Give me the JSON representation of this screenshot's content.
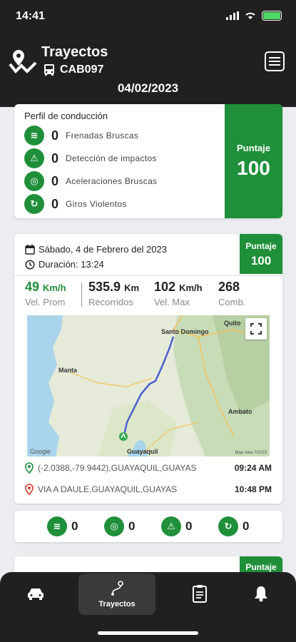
{
  "status_bar": {
    "time": "14:41"
  },
  "header": {
    "title": "Trayectos",
    "vehicle": "CAB097",
    "date": "04/02/2023"
  },
  "profile": {
    "title": "Perfil de conducción",
    "metrics": [
      {
        "value": "0",
        "label": "Frenadas Bruscas",
        "icon": "hard-brake-icon"
      },
      {
        "value": "0",
        "label": "Detección de impactos",
        "icon": "impact-detection-icon"
      },
      {
        "value": "0",
        "label": "Aceleraciones Bruscas",
        "icon": "hard-acceleration-icon"
      },
      {
        "value": "0",
        "label": "Giros Violentos",
        "icon": "sharp-turn-icon"
      }
    ],
    "score_label": "Puntaje",
    "score_value": "100"
  },
  "trip": {
    "date": "Sábado, 4 de Febrero del 2023",
    "duration": "Duración: 13:24",
    "score_label": "Puntaje",
    "score_value": "100",
    "stats": {
      "avg_speed": {
        "value": "49",
        "unit": "Km/h",
        "label": "Vel. Prom"
      },
      "distance": {
        "value": "535.9",
        "unit": "Km",
        "label": "Recorridos"
      },
      "max_speed": {
        "value": "102",
        "unit": "Km/h",
        "label": "Vel. Max"
      },
      "fuel": {
        "value": "268",
        "label": "Comb."
      }
    },
    "map": {
      "label_quito": "Quito",
      "label_santo_domingo": "Santo Domingo",
      "label_manta": "Manta",
      "label_ambato": "Ambato",
      "label_guayaquil": "Guayaquil",
      "google": "Google",
      "credit": "Map data ©2023"
    },
    "origin": {
      "address": "(-2.0388,-79.9442),GUAYAQUIL,GUAYAS",
      "time": "09:24 AM"
    },
    "destination": {
      "address": "VIA A DAULE,GUAYAQUIL,GUAYAS",
      "time": "10:48 PM"
    },
    "events": [
      {
        "icon": "hard-brake-icon",
        "value": "0"
      },
      {
        "icon": "hard-acceleration-icon",
        "value": "0"
      },
      {
        "icon": "impact-detection-icon",
        "value": "0"
      },
      {
        "icon": "sharp-turn-icon",
        "value": "0"
      }
    ]
  },
  "next_trip": {
    "score_label": "Puntaje"
  },
  "tabbar": {
    "active_label": "Trayectos"
  },
  "colors": {
    "brand_green": "#1f8f3a",
    "header_bg": "#202020"
  }
}
